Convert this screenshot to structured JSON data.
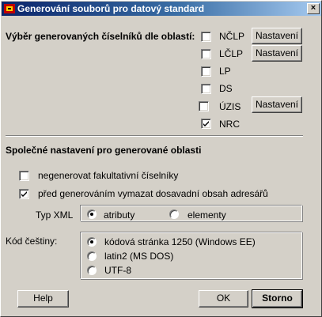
{
  "window": {
    "title": "Generování souborů pro datový standard",
    "close_glyph": "×"
  },
  "areas": {
    "heading": "Výběr generovaných číselníků dle oblastí:",
    "items": [
      {
        "label": "NČLP",
        "checked": false,
        "has_settings": true
      },
      {
        "label": "LČLP",
        "checked": false,
        "has_settings": true
      },
      {
        "label": "LP",
        "checked": false,
        "has_settings": false
      },
      {
        "label": "DS",
        "checked": false,
        "has_settings": false
      },
      {
        "label": "ÚZIS",
        "checked": false,
        "has_settings": true
      },
      {
        "label": "NRC",
        "checked": true,
        "has_settings": false
      }
    ],
    "settings_label": "Nastavení"
  },
  "common": {
    "heading": "Společné nastavení pro generované oblasti",
    "no_optional": {
      "label": "negenerovat fakultativní číselníky",
      "checked": false
    },
    "clear_dir": {
      "label": "před generováním vymazat dosavadní obsah adresářů",
      "checked": true
    }
  },
  "xml_type": {
    "label": "Typ XML",
    "options": [
      "atributy",
      "elementy"
    ],
    "selected": "atributy"
  },
  "encoding": {
    "label": "Kód češtiny:",
    "options": [
      "kódová stránka 1250 (Windows EE)",
      "latin2 (MS DOS)",
      "UTF-8"
    ],
    "selected": "kódová stránka 1250 (Windows EE)"
  },
  "buttons": {
    "help": "Help",
    "ok": "OK",
    "cancel": "Storno"
  }
}
